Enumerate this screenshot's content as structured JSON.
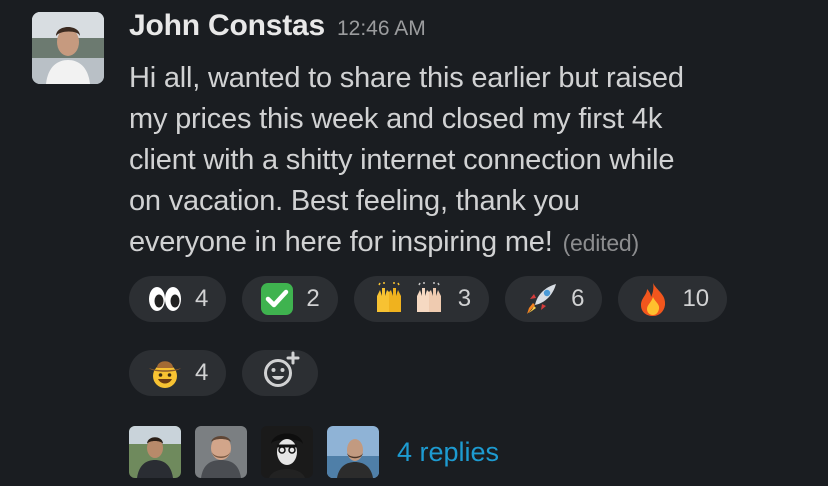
{
  "message": {
    "author": "John Constas",
    "time": "12:46 AM",
    "lines": [
      "Hi all, wanted to share this earlier but raised",
      "my prices this week and closed my first 4k",
      "client with a shitty internet connection while",
      "on vacation. Best feeling, thank you",
      "everyone in here for inspiring me!"
    ],
    "edited_label": "(edited)"
  },
  "reactions": [
    {
      "emoji": "eyes-icon",
      "count": "4"
    },
    {
      "emoji": "check-mark-icon",
      "count": "2"
    },
    {
      "emoji": "raised-hands-icon",
      "count": "3"
    },
    {
      "emoji": "rocket-icon",
      "count": "6"
    },
    {
      "emoji": "fire-icon",
      "count": "10"
    },
    {
      "emoji": "cowboy-face-icon",
      "count": "4"
    }
  ],
  "add_reaction": {
    "icon": "add-reaction-icon"
  },
  "thread": {
    "replies_label": "4 replies",
    "avatars": [
      "reply-avatar-1",
      "reply-avatar-2",
      "reply-avatar-3",
      "reply-avatar-4"
    ]
  },
  "colors": {
    "background": "#1a1d21",
    "pill": "#2c2f33",
    "link": "#1d9bd1",
    "text": "#d1d2d3"
  }
}
